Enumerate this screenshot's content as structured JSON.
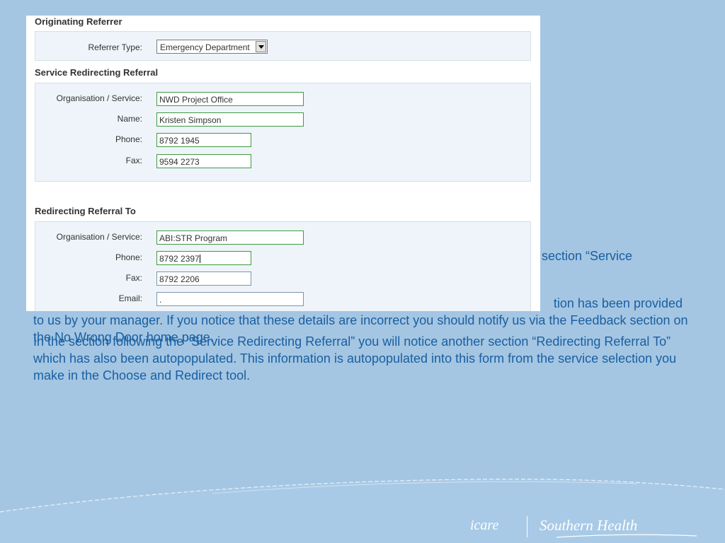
{
  "form": {
    "originating_referrer": {
      "title": "Originating Referrer",
      "referrer_type_label": "Referrer Type:",
      "referrer_type_value": "Emergency Department"
    },
    "service_redirecting_referral": {
      "title": "Service Redirecting Referral",
      "org_label": "Organisation / Service:",
      "org_value": "NWD Project Office",
      "name_label": "Name:",
      "name_value": "Kristen Simpson",
      "phone_label": "Phone:",
      "phone_value": "8792 1945",
      "fax_label": "Fax:",
      "fax_value": "9594 2273"
    },
    "redirecting_referral_to": {
      "title": "Redirecting Referral To",
      "org_label": "Organisation / Service:",
      "org_value": "ABI:STR Program",
      "phone_label": "Phone:",
      "phone_value": "8792 2397",
      "fax_label": "Fax:",
      "fax_value": "8792 2206",
      "email_label": "Email:",
      "email_value": "."
    }
  },
  "slide": {
    "fragment_top": ": section “Service",
    "para1_line1": "tion has been provided",
    "para1_rest": "to us by your manager.  If you notice that these details are incorrect you should notify us via the Feedback section on the No Wrong Door home page.",
    "para2": "In the section following the “Service Redirecting Referral” you will notice another section “Redirecting Referral To” which has also been autopopulated.  This information is autopopulated into this form from the service selection you make in the Choose and Redirect tool."
  },
  "footer": {
    "icare_logo": "icare",
    "southern_health_logo": "Southern Health"
  },
  "colors": {
    "background": "#a4c6e3",
    "text": "#1a5fa0",
    "field_border_active": "#3f9b3f"
  }
}
